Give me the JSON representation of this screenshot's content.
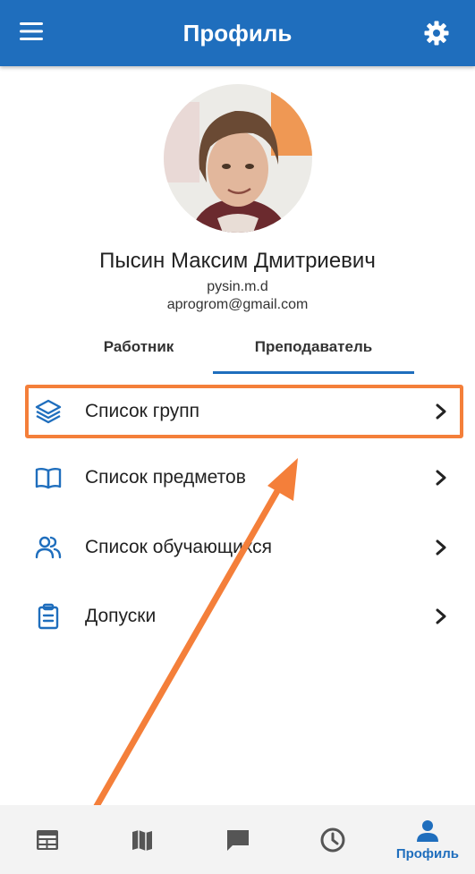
{
  "app_bar": {
    "title": "Профиль",
    "menu_icon": "menu-icon",
    "settings_icon": "gear-icon"
  },
  "profile": {
    "full_name": "Пысин Максим Дмитриевич",
    "login": "pysin.m.d",
    "email": "aprogrom@gmail.com"
  },
  "tabs": [
    {
      "label": "Работник",
      "active": false
    },
    {
      "label": "Преподаватель",
      "active": true
    }
  ],
  "menu": [
    {
      "label": "Список групп",
      "icon": "layers-icon"
    },
    {
      "label": "Список предметов",
      "icon": "book-icon"
    },
    {
      "label": "Список обучающихся",
      "icon": "users-icon"
    },
    {
      "label": "Допуски",
      "icon": "clipboard-icon"
    }
  ],
  "bottom_nav": [
    {
      "icon": "schedule-icon",
      "label": ""
    },
    {
      "icon": "map-icon",
      "label": ""
    },
    {
      "icon": "chat-icon",
      "label": ""
    },
    {
      "icon": "clock-icon",
      "label": ""
    },
    {
      "icon": "profile-icon",
      "label": "Профиль",
      "active": true
    }
  ],
  "colors": {
    "primary": "#1f6ebd",
    "annotation": "#f47f3a"
  }
}
